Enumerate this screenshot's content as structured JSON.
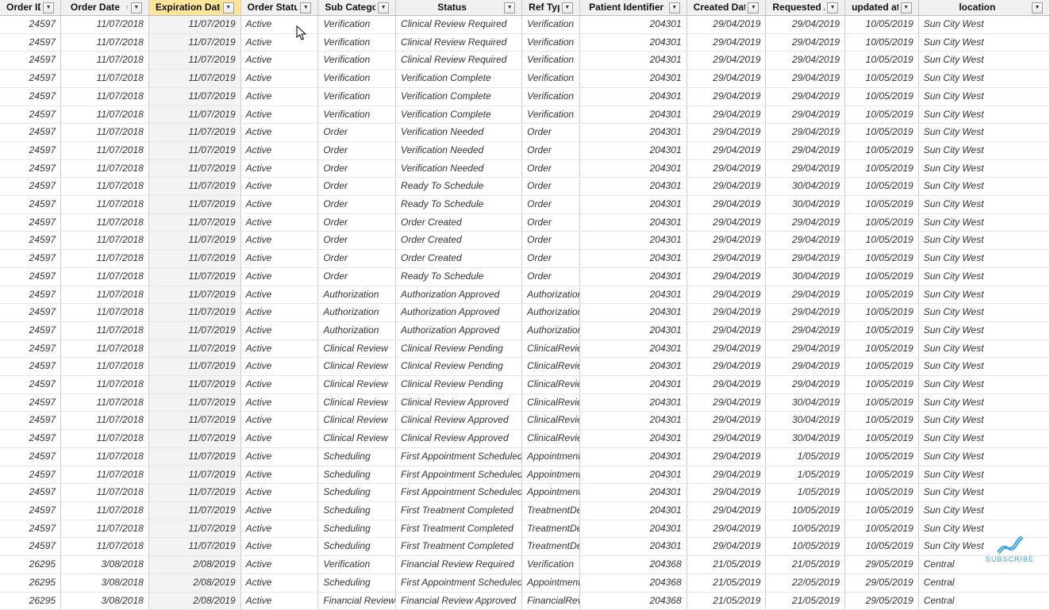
{
  "columns": [
    {
      "key": "order_id",
      "label": "Order ID",
      "align": "right",
      "sorted": false
    },
    {
      "key": "order_date",
      "label": "Order Date",
      "align": "right",
      "sorted": false,
      "sort_ind": true
    },
    {
      "key": "expiration_date",
      "label": "Expiration Date",
      "align": "right",
      "sorted": true
    },
    {
      "key": "order_status",
      "label": "Order Status",
      "align": "left",
      "sorted": false
    },
    {
      "key": "sub_category",
      "label": "Sub Category",
      "align": "left",
      "sorted": false
    },
    {
      "key": "status",
      "label": "Status",
      "align": "left",
      "sorted": false
    },
    {
      "key": "ref_type",
      "label": "Ref Type",
      "align": "left",
      "sorted": false
    },
    {
      "key": "patient_identifier",
      "label": "Patient Identifier",
      "align": "right",
      "sorted": false
    },
    {
      "key": "created_date",
      "label": "Created Date",
      "align": "right",
      "sorted": false
    },
    {
      "key": "requested_at",
      "label": "Requested At",
      "align": "right",
      "sorted": false
    },
    {
      "key": "updated_at",
      "label": "updated at",
      "align": "right",
      "sorted": false
    },
    {
      "key": "location",
      "label": "location",
      "align": "left",
      "sorted": false
    }
  ],
  "rows": [
    [
      "24597",
      "11/07/2018",
      "11/07/2019",
      "Active",
      "Verification",
      "Clinical Review Required",
      "Verification",
      "204301",
      "29/04/2019",
      "29/04/2019",
      "10/05/2019",
      "Sun City West"
    ],
    [
      "24597",
      "11/07/2018",
      "11/07/2019",
      "Active",
      "Verification",
      "Clinical Review Required",
      "Verification",
      "204301",
      "29/04/2019",
      "29/04/2019",
      "10/05/2019",
      "Sun City West"
    ],
    [
      "24597",
      "11/07/2018",
      "11/07/2019",
      "Active",
      "Verification",
      "Clinical Review Required",
      "Verification",
      "204301",
      "29/04/2019",
      "29/04/2019",
      "10/05/2019",
      "Sun City West"
    ],
    [
      "24597",
      "11/07/2018",
      "11/07/2019",
      "Active",
      "Verification",
      "Verification Complete",
      "Verification",
      "204301",
      "29/04/2019",
      "29/04/2019",
      "10/05/2019",
      "Sun City West"
    ],
    [
      "24597",
      "11/07/2018",
      "11/07/2019",
      "Active",
      "Verification",
      "Verification Complete",
      "Verification",
      "204301",
      "29/04/2019",
      "29/04/2019",
      "10/05/2019",
      "Sun City West"
    ],
    [
      "24597",
      "11/07/2018",
      "11/07/2019",
      "Active",
      "Verification",
      "Verification Complete",
      "Verification",
      "204301",
      "29/04/2019",
      "29/04/2019",
      "10/05/2019",
      "Sun City West"
    ],
    [
      "24597",
      "11/07/2018",
      "11/07/2019",
      "Active",
      "Order",
      "Verification Needed",
      "Order",
      "204301",
      "29/04/2019",
      "29/04/2019",
      "10/05/2019",
      "Sun City West"
    ],
    [
      "24597",
      "11/07/2018",
      "11/07/2019",
      "Active",
      "Order",
      "Verification Needed",
      "Order",
      "204301",
      "29/04/2019",
      "29/04/2019",
      "10/05/2019",
      "Sun City West"
    ],
    [
      "24597",
      "11/07/2018",
      "11/07/2019",
      "Active",
      "Order",
      "Verification Needed",
      "Order",
      "204301",
      "29/04/2019",
      "29/04/2019",
      "10/05/2019",
      "Sun City West"
    ],
    [
      "24597",
      "11/07/2018",
      "11/07/2019",
      "Active",
      "Order",
      "Ready To Schedule",
      "Order",
      "204301",
      "29/04/2019",
      "30/04/2019",
      "10/05/2019",
      "Sun City West"
    ],
    [
      "24597",
      "11/07/2018",
      "11/07/2019",
      "Active",
      "Order",
      "Ready To Schedule",
      "Order",
      "204301",
      "29/04/2019",
      "30/04/2019",
      "10/05/2019",
      "Sun City West"
    ],
    [
      "24597",
      "11/07/2018",
      "11/07/2019",
      "Active",
      "Order",
      "Order Created",
      "Order",
      "204301",
      "29/04/2019",
      "29/04/2019",
      "10/05/2019",
      "Sun City West"
    ],
    [
      "24597",
      "11/07/2018",
      "11/07/2019",
      "Active",
      "Order",
      "Order Created",
      "Order",
      "204301",
      "29/04/2019",
      "29/04/2019",
      "10/05/2019",
      "Sun City West"
    ],
    [
      "24597",
      "11/07/2018",
      "11/07/2019",
      "Active",
      "Order",
      "Order Created",
      "Order",
      "204301",
      "29/04/2019",
      "29/04/2019",
      "10/05/2019",
      "Sun City West"
    ],
    [
      "24597",
      "11/07/2018",
      "11/07/2019",
      "Active",
      "Order",
      "Ready To Schedule",
      "Order",
      "204301",
      "29/04/2019",
      "30/04/2019",
      "10/05/2019",
      "Sun City West"
    ],
    [
      "24597",
      "11/07/2018",
      "11/07/2019",
      "Active",
      "Authorization",
      "Authorization Approved",
      "Authorization",
      "204301",
      "29/04/2019",
      "29/04/2019",
      "10/05/2019",
      "Sun City West"
    ],
    [
      "24597",
      "11/07/2018",
      "11/07/2019",
      "Active",
      "Authorization",
      "Authorization Approved",
      "Authorization",
      "204301",
      "29/04/2019",
      "29/04/2019",
      "10/05/2019",
      "Sun City West"
    ],
    [
      "24597",
      "11/07/2018",
      "11/07/2019",
      "Active",
      "Authorization",
      "Authorization Approved",
      "Authorization",
      "204301",
      "29/04/2019",
      "29/04/2019",
      "10/05/2019",
      "Sun City West"
    ],
    [
      "24597",
      "11/07/2018",
      "11/07/2019",
      "Active",
      "Clinical Review",
      "Clinical Review Pending",
      "ClinicalReview",
      "204301",
      "29/04/2019",
      "29/04/2019",
      "10/05/2019",
      "Sun City West"
    ],
    [
      "24597",
      "11/07/2018",
      "11/07/2019",
      "Active",
      "Clinical Review",
      "Clinical Review Pending",
      "ClinicalReview",
      "204301",
      "29/04/2019",
      "29/04/2019",
      "10/05/2019",
      "Sun City West"
    ],
    [
      "24597",
      "11/07/2018",
      "11/07/2019",
      "Active",
      "Clinical Review",
      "Clinical Review Pending",
      "ClinicalReview",
      "204301",
      "29/04/2019",
      "29/04/2019",
      "10/05/2019",
      "Sun City West"
    ],
    [
      "24597",
      "11/07/2018",
      "11/07/2019",
      "Active",
      "Clinical Review",
      "Clinical Review Approved",
      "ClinicalReview",
      "204301",
      "29/04/2019",
      "30/04/2019",
      "10/05/2019",
      "Sun City West"
    ],
    [
      "24597",
      "11/07/2018",
      "11/07/2019",
      "Active",
      "Clinical Review",
      "Clinical Review Approved",
      "ClinicalReview",
      "204301",
      "29/04/2019",
      "30/04/2019",
      "10/05/2019",
      "Sun City West"
    ],
    [
      "24597",
      "11/07/2018",
      "11/07/2019",
      "Active",
      "Clinical Review",
      "Clinical Review Approved",
      "ClinicalReview",
      "204301",
      "29/04/2019",
      "30/04/2019",
      "10/05/2019",
      "Sun City West"
    ],
    [
      "24597",
      "11/07/2018",
      "11/07/2019",
      "Active",
      "Scheduling",
      "First Appointment Scheduled",
      "Appointment",
      "204301",
      "29/04/2019",
      "1/05/2019",
      "10/05/2019",
      "Sun City West"
    ],
    [
      "24597",
      "11/07/2018",
      "11/07/2019",
      "Active",
      "Scheduling",
      "First Appointment Scheduled",
      "Appointment",
      "204301",
      "29/04/2019",
      "1/05/2019",
      "10/05/2019",
      "Sun City West"
    ],
    [
      "24597",
      "11/07/2018",
      "11/07/2019",
      "Active",
      "Scheduling",
      "First Appointment Scheduled",
      "Appointment",
      "204301",
      "29/04/2019",
      "1/05/2019",
      "10/05/2019",
      "Sun City West"
    ],
    [
      "24597",
      "11/07/2018",
      "11/07/2019",
      "Active",
      "Scheduling",
      "First Treatment Completed",
      "TreatmentDetail",
      "204301",
      "29/04/2019",
      "10/05/2019",
      "10/05/2019",
      "Sun City West"
    ],
    [
      "24597",
      "11/07/2018",
      "11/07/2019",
      "Active",
      "Scheduling",
      "First Treatment Completed",
      "TreatmentDetail",
      "204301",
      "29/04/2019",
      "10/05/2019",
      "10/05/2019",
      "Sun City West"
    ],
    [
      "24597",
      "11/07/2018",
      "11/07/2019",
      "Active",
      "Scheduling",
      "First Treatment Completed",
      "TreatmentDetail",
      "204301",
      "29/04/2019",
      "10/05/2019",
      "10/05/2019",
      "Sun City West"
    ],
    [
      "26295",
      "3/08/2018",
      "2/08/2019",
      "Active",
      "Verification",
      "Financial Review Required",
      "Verification",
      "204368",
      "21/05/2019",
      "21/05/2019",
      "29/05/2019",
      "Central"
    ],
    [
      "26295",
      "3/08/2018",
      "2/08/2019",
      "Active",
      "Scheduling",
      "First Appointment Scheduled",
      "Appointment",
      "204368",
      "21/05/2019",
      "22/05/2019",
      "29/05/2019",
      "Central"
    ],
    [
      "26295",
      "3/08/2018",
      "2/08/2019",
      "Active",
      "Financial Reviews",
      "Financial Review Approved",
      "FinancialReview",
      "204368",
      "21/05/2019",
      "21/05/2019",
      "29/05/2019",
      "Central"
    ]
  ],
  "watermark": {
    "text": "SUBSCRIBE"
  }
}
